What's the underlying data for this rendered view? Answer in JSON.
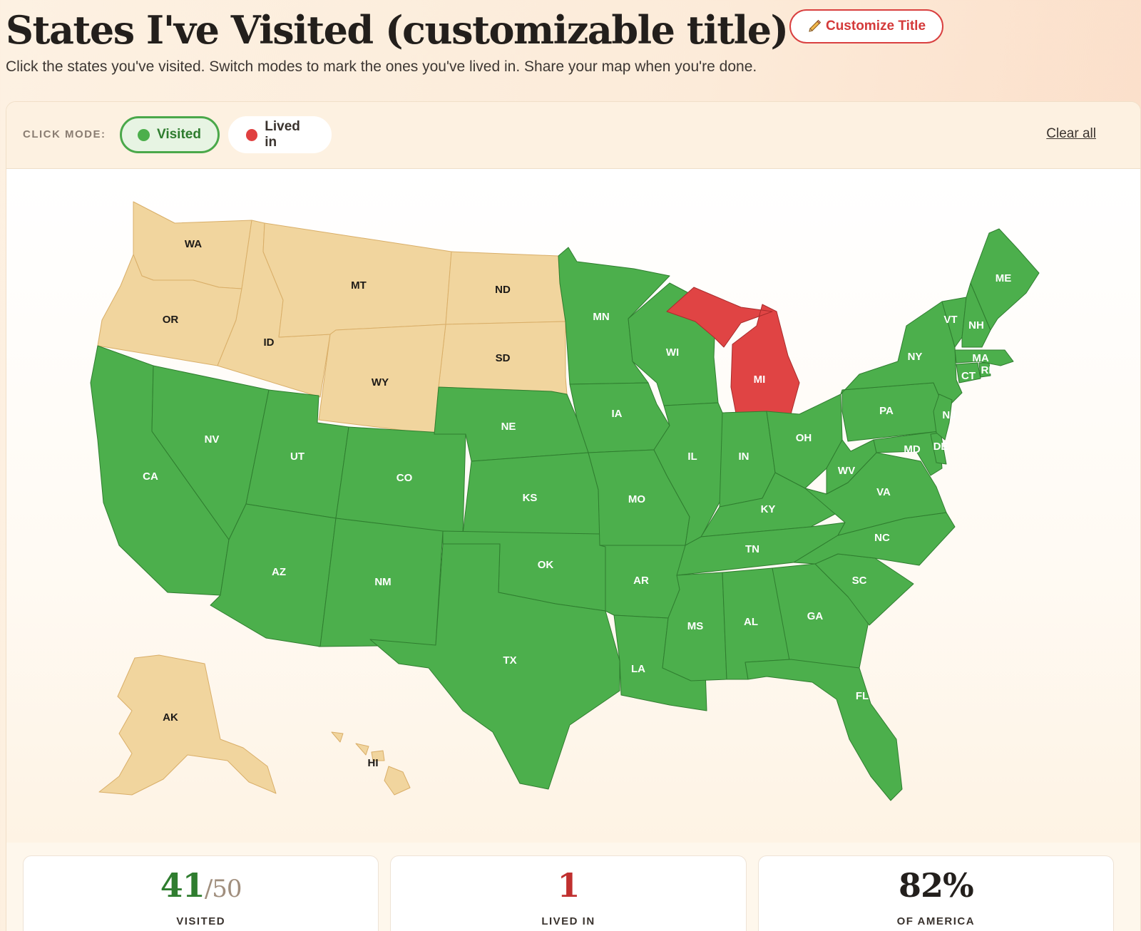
{
  "header": {
    "title": "States I've Visited (customizable title)",
    "customize_icon": "pencil-icon",
    "customize_label": "Customize Title",
    "subtitle": "Click the states you've visited. Switch modes to mark the ones you've lived in. Share your map when you're done."
  },
  "toolbar": {
    "mode_label": "CLICK MODE:",
    "modes": [
      {
        "label": "Visited",
        "color": "#4caf4c",
        "selected": true
      },
      {
        "label": "Lived in",
        "color": "#e04040",
        "selected": false
      }
    ],
    "clear_label": "Clear all"
  },
  "colors": {
    "visited": "#4caf4c",
    "visited_stroke": "#2f7d2f",
    "lived": "#e04444",
    "lived_stroke": "#a82c2c",
    "unvisited": "#f1d59e",
    "unvisited_stroke": "#d9ae68"
  },
  "states": [
    {
      "code": "WA",
      "status": "unvisited"
    },
    {
      "code": "OR",
      "status": "unvisited"
    },
    {
      "code": "ID",
      "status": "unvisited"
    },
    {
      "code": "MT",
      "status": "unvisited"
    },
    {
      "code": "ND",
      "status": "unvisited"
    },
    {
      "code": "SD",
      "status": "unvisited"
    },
    {
      "code": "WY",
      "status": "unvisited"
    },
    {
      "code": "AK",
      "status": "unvisited"
    },
    {
      "code": "HI",
      "status": "unvisited"
    },
    {
      "code": "CA",
      "status": "visited"
    },
    {
      "code": "NV",
      "status": "visited"
    },
    {
      "code": "UT",
      "status": "visited"
    },
    {
      "code": "AZ",
      "status": "visited"
    },
    {
      "code": "CO",
      "status": "visited"
    },
    {
      "code": "NM",
      "status": "visited"
    },
    {
      "code": "NE",
      "status": "visited"
    },
    {
      "code": "KS",
      "status": "visited"
    },
    {
      "code": "OK",
      "status": "visited"
    },
    {
      "code": "TX",
      "status": "visited"
    },
    {
      "code": "MN",
      "status": "visited"
    },
    {
      "code": "IA",
      "status": "visited"
    },
    {
      "code": "MO",
      "status": "visited"
    },
    {
      "code": "AR",
      "status": "visited"
    },
    {
      "code": "LA",
      "status": "visited"
    },
    {
      "code": "WI",
      "status": "visited"
    },
    {
      "code": "MI",
      "status": "lived"
    },
    {
      "code": "IL",
      "status": "visited"
    },
    {
      "code": "IN",
      "status": "visited"
    },
    {
      "code": "OH",
      "status": "visited"
    },
    {
      "code": "KY",
      "status": "visited"
    },
    {
      "code": "TN",
      "status": "visited"
    },
    {
      "code": "MS",
      "status": "visited"
    },
    {
      "code": "AL",
      "status": "visited"
    },
    {
      "code": "GA",
      "status": "visited"
    },
    {
      "code": "FL",
      "status": "visited"
    },
    {
      "code": "SC",
      "status": "visited"
    },
    {
      "code": "NC",
      "status": "visited"
    },
    {
      "code": "VA",
      "status": "visited"
    },
    {
      "code": "WV",
      "status": "visited"
    },
    {
      "code": "PA",
      "status": "visited"
    },
    {
      "code": "NY",
      "status": "visited"
    },
    {
      "code": "MD",
      "status": "visited"
    },
    {
      "code": "DE",
      "status": "visited"
    },
    {
      "code": "NJ",
      "status": "visited"
    },
    {
      "code": "CT",
      "status": "visited"
    },
    {
      "code": "RI",
      "status": "visited"
    },
    {
      "code": "MA",
      "status": "visited"
    },
    {
      "code": "VT",
      "status": "visited"
    },
    {
      "code": "NH",
      "status": "visited"
    },
    {
      "code": "ME",
      "status": "visited"
    }
  ],
  "stats": {
    "visited": {
      "value": "41",
      "of": "/50",
      "label": "VISITED",
      "color": "#2f7d2f"
    },
    "lived": {
      "value": "1",
      "label": "LIVED IN",
      "color": "#c0302f"
    },
    "america": {
      "value": "82%",
      "label": "OF AMERICA",
      "color": "#231f1c"
    }
  }
}
